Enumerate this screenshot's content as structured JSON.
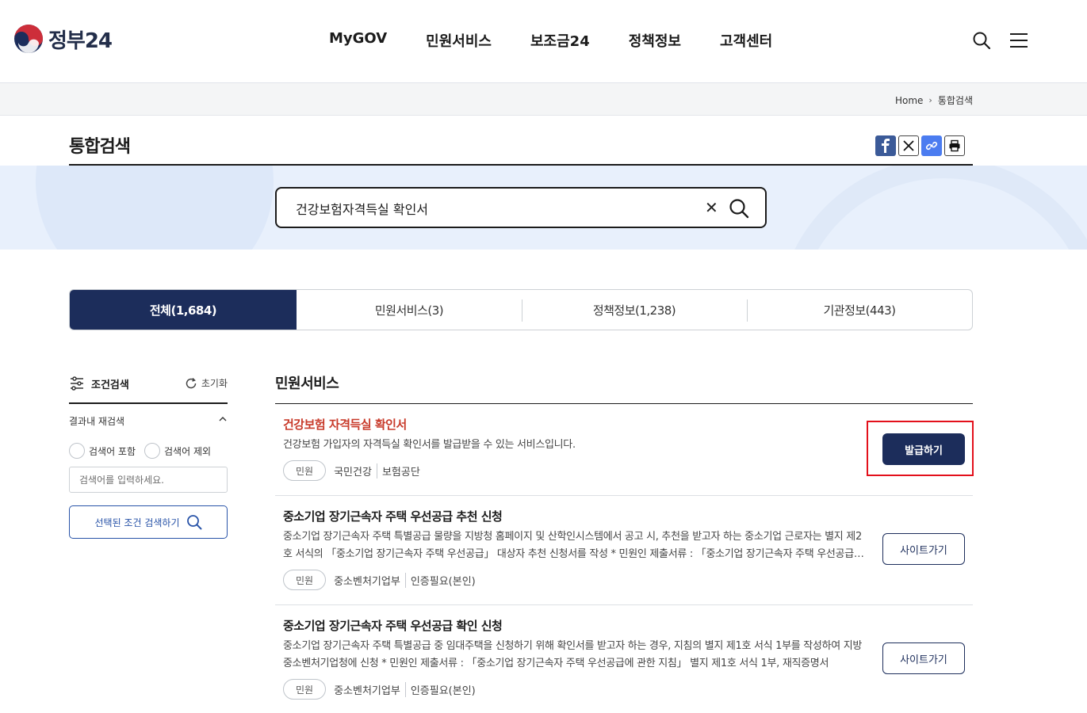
{
  "header": {
    "logo_text": "정부24",
    "nav": [
      "MyGOV",
      "민원서비스",
      "보조금24",
      "정책정보",
      "고객센터"
    ],
    "search_icon": "search-icon",
    "menu_icon": "hamburger-menu-icon"
  },
  "breadcrumb": {
    "home": "Home",
    "current": "통합검색"
  },
  "page": {
    "title": "통합검색"
  },
  "share": [
    "facebook-icon",
    "x-icon",
    "link-icon",
    "print-icon"
  ],
  "search": {
    "value": "건강보험자격득실 확인서"
  },
  "tabs": [
    {
      "label": "전체(1,684)",
      "active": true
    },
    {
      "label": "민원서비스(3)",
      "active": false
    },
    {
      "label": "정책정보(1,238)",
      "active": false
    },
    {
      "label": "기관정보(443)",
      "active": false
    }
  ],
  "filter": {
    "title": "조건검색",
    "reset": "초기화",
    "refine_label": "결과내 재검색",
    "include": "검색어 포함",
    "exclude": "검색어 제외",
    "input_placeholder": "검색어를 입력하세요.",
    "search_button": "선택된 조건 검색하기"
  },
  "results_section": "민원서비스",
  "results": [
    {
      "title": "건강보험 자격득실 확인서",
      "desc": "건강보험 가입자의 자격득실 확인서를 발급받을 수 있는 서비스입니다.",
      "badge": "민원",
      "orgs": [
        "국민건강",
        "보험공단"
      ],
      "button": "발급하기"
    },
    {
      "title": "중소기업 장기근속자 주택 우선공급 추천 신청",
      "desc": "중소기업 장기근속자 주택 특별공급 물량을 지방청 홈페이지 및 산학인시스템에서 공고 시, 추천을 받고자 하는 중소기업 근로자는 별지 제2호 서식의 「중소기업 장기근속자 주택 우선공급」 대상자 추천 신청서를 작성 * 민원인 제출서류 : 「중소기업 장기근속자 주택 우선공급에 관한 지침」",
      "badge": "민원",
      "orgs": [
        "중소벤처기업부",
        "인증필요(본인)"
      ],
      "button": "사이트가기"
    },
    {
      "title": "중소기업 장기근속자 주택 우선공급 확인 신청",
      "desc": "중소기업 장기근속자 주택 특별공급 중 임대주택을 신청하기 위해 확인서를 받고자 하는 경우, 지침의 별지 제1호 서식 1부를 작성하여 지방중소벤처기업청에 신청 * 민원인 제출서류 : 「중소기업 장기근속자 주택 우선공급에 관한 지침」 별지 제1호 서식 1부, 재직증명서",
      "badge": "민원",
      "orgs": [
        "중소벤처기업부",
        "인증필요(본인)"
      ],
      "button": "사이트가기"
    }
  ]
}
